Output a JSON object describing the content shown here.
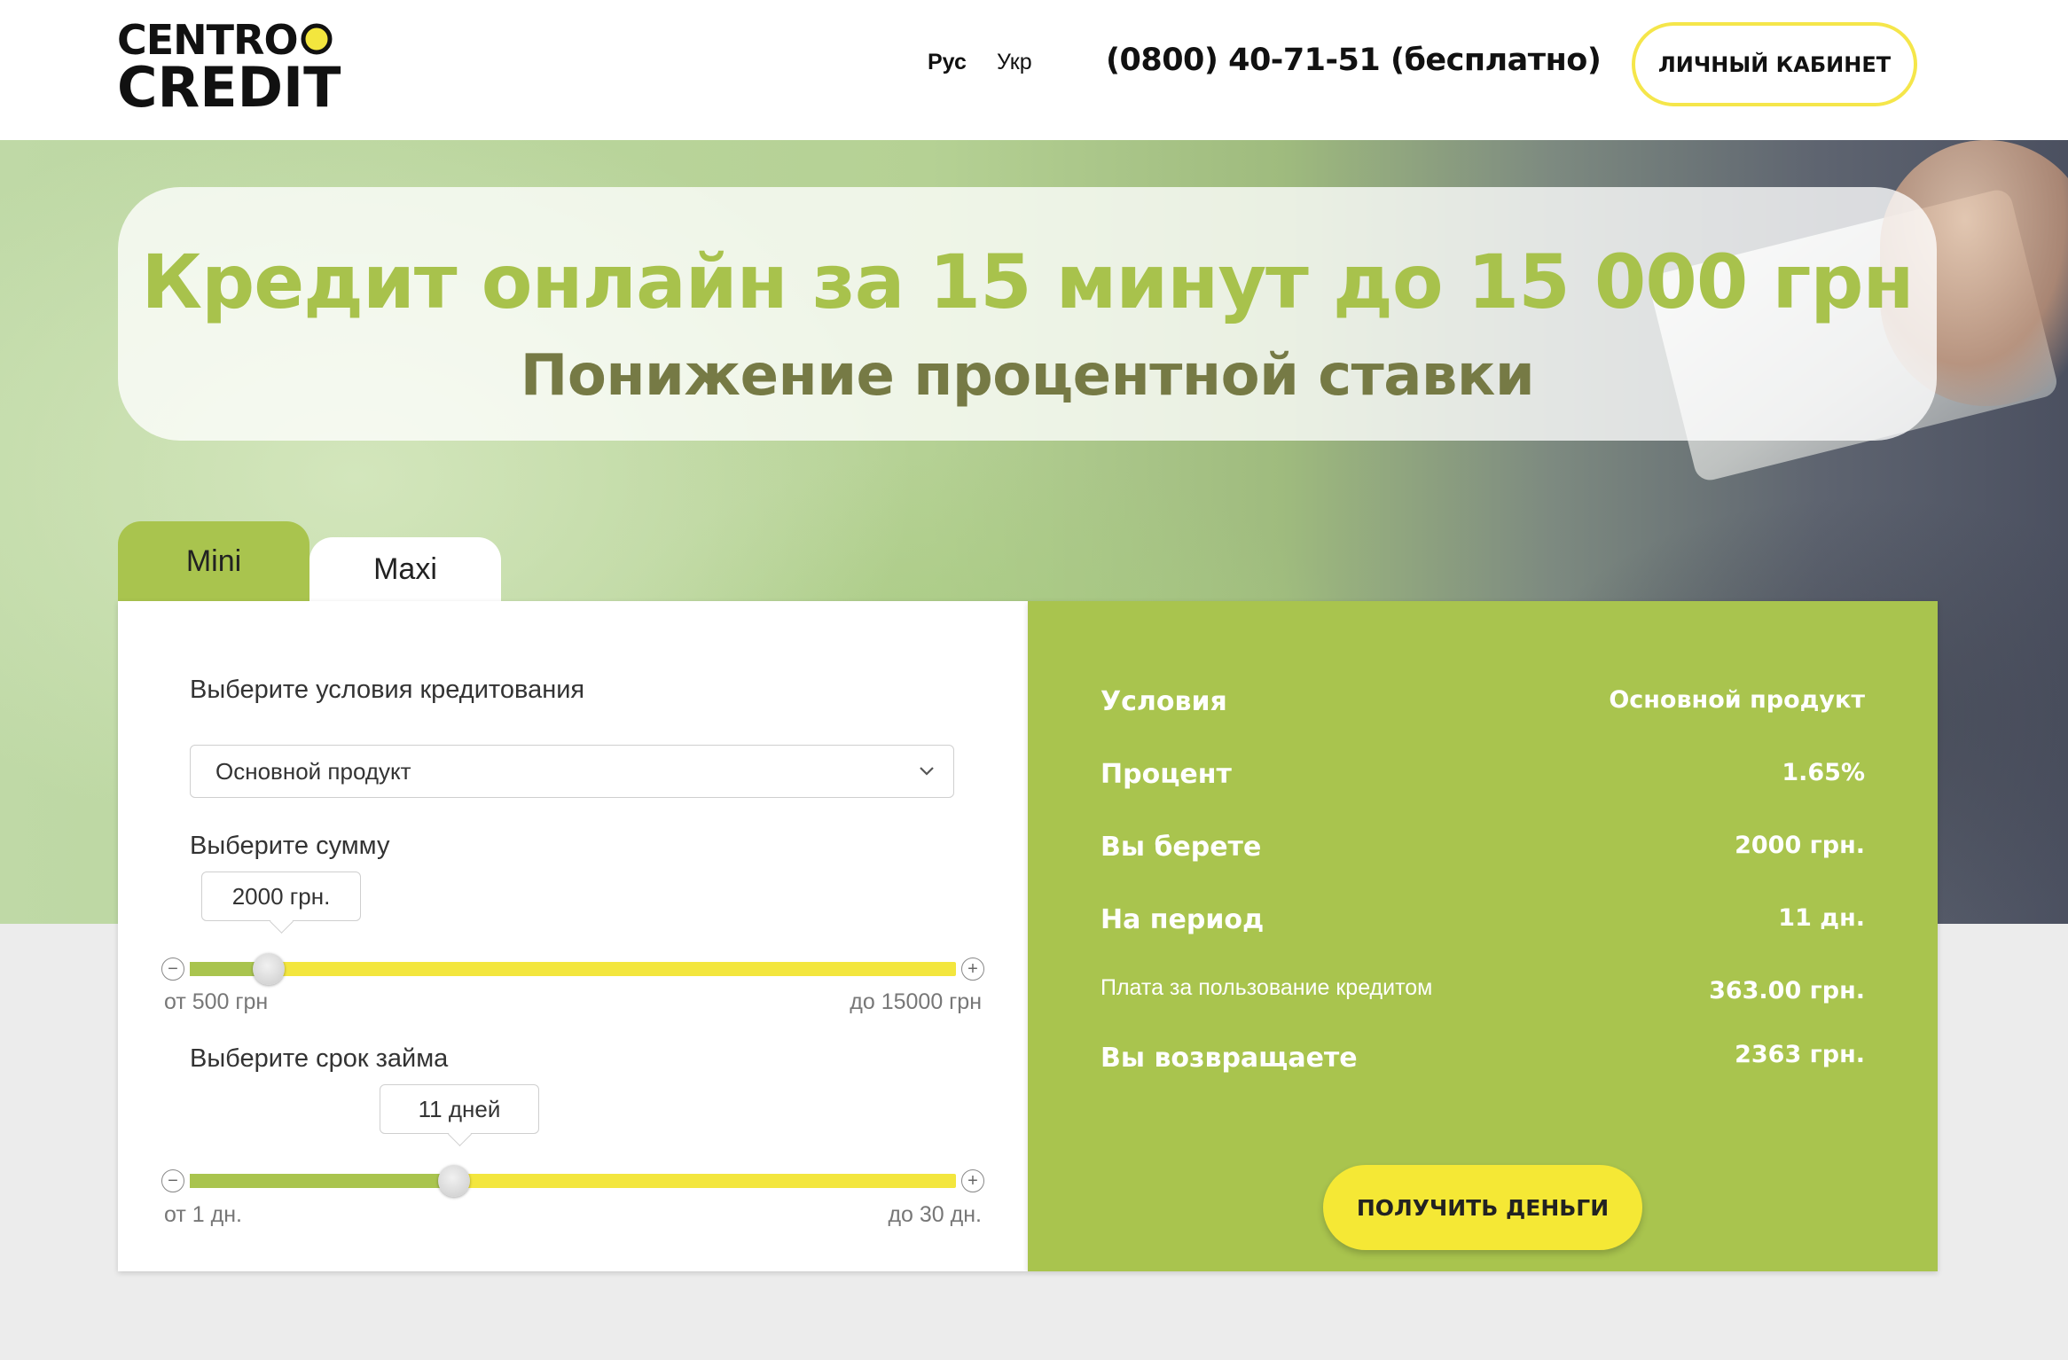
{
  "header": {
    "logo_line1": "CENTRO",
    "logo_line2": "CREDIT",
    "lang_ru": "Рус",
    "lang_ua": "Укр",
    "phone": "(0800) 40-71-51 (бесплатно)",
    "cabinet_label": "ЛИЧНЫЙ КАБИНЕТ"
  },
  "hero": {
    "title": "Кредит онлайн за 15 минут до 15 000 грн",
    "subtitle": "Понижение процентной ставки"
  },
  "tabs": [
    {
      "label": "Mini",
      "active": true
    },
    {
      "label": "Maxi",
      "active": false
    }
  ],
  "calculator": {
    "conditions_label": "Выберите условия кредитования",
    "product_select": {
      "value": "Основной продукт"
    },
    "amount": {
      "label": "Выберите сумму",
      "value_text": "2000 грн.",
      "min_label": "от 500 грн",
      "max_label": "до 15000 грн",
      "min": 500,
      "max": 15000,
      "value": 2000
    },
    "term": {
      "label": "Выберите срок займа",
      "value_text": "11 дней",
      "min_label": "от 1 дн.",
      "max_label": "до 30 дн.",
      "min": 1,
      "max": 30,
      "value": 11
    },
    "minus_symbol": "−",
    "plus_symbol": "+"
  },
  "summary": {
    "rows": [
      {
        "label": "Условия",
        "value": "Основной продукт"
      },
      {
        "label": "Процент",
        "value": "1.65%"
      },
      {
        "label": "Вы берете",
        "value": "2000 грн."
      },
      {
        "label": "На период",
        "value": "11 дн."
      },
      {
        "label": "Плата за пользование кредитом",
        "value": "363.00 грн."
      },
      {
        "label": "Вы возвращаете",
        "value": "2363 грн."
      }
    ],
    "button_label": "ПОЛУЧИТЬ ДЕНЬГИ"
  },
  "colors": {
    "accent_green": "#a9c44e",
    "accent_yellow": "#f5e835",
    "title_green": "#a8c24c",
    "subtitle_olive": "#767a45"
  },
  "icons": {
    "logo_dot": "yellow-circle",
    "select_chevron": "chevron-down-icon"
  }
}
